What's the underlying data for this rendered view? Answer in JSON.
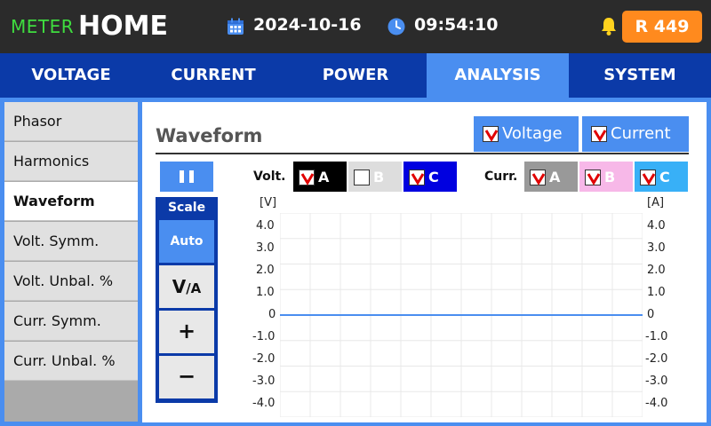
{
  "header": {
    "brand_small": "METER",
    "brand_big": "HOME",
    "date": "2024-10-16",
    "time": "09:54:10",
    "badge": "R 449",
    "icons": [
      "calendar-icon",
      "clock-icon",
      "bell-icon"
    ],
    "colors": {
      "brand_small": "#3fdc3f",
      "badge": "#ff8a1e",
      "bell": "#ffd21e"
    }
  },
  "tabs": [
    {
      "label": "VOLTAGE",
      "active": false
    },
    {
      "label": "CURRENT",
      "active": false
    },
    {
      "label": "POWER",
      "active": false
    },
    {
      "label": "ANALYSIS",
      "active": true
    },
    {
      "label": "SYSTEM",
      "active": false
    }
  ],
  "sidebar": {
    "items": [
      {
        "label": "Phasor",
        "active": false
      },
      {
        "label": "Harmonics",
        "active": false
      },
      {
        "label": "Waveform",
        "active": true
      },
      {
        "label": "Volt. Symm.",
        "active": false
      },
      {
        "label": "Volt. Unbal. %",
        "active": false
      },
      {
        "label": "Curr. Symm.",
        "active": false
      },
      {
        "label": "Curr. Unbal. %",
        "active": false
      }
    ]
  },
  "main": {
    "title": "Waveform",
    "toggles": {
      "voltage": {
        "label": "Voltage",
        "checked": true
      },
      "current": {
        "label": "Current",
        "checked": true
      }
    },
    "volt_label": "Volt.",
    "curr_label": "Curr.",
    "volt_phases": [
      {
        "label": "A",
        "checked": true,
        "color": "#000000"
      },
      {
        "label": "B",
        "checked": false,
        "color": "#dddddd"
      },
      {
        "label": "C",
        "checked": true,
        "color": "#0000e0"
      }
    ],
    "curr_phases": [
      {
        "label": "A",
        "checked": true,
        "color": "#999999"
      },
      {
        "label": "B",
        "checked": true,
        "color": "#f7b8e8"
      },
      {
        "label": "C",
        "checked": true,
        "color": "#38b0f7"
      }
    ],
    "scale": {
      "title": "Scale",
      "auto": "Auto",
      "va_main": "V",
      "va_sub": "/A",
      "plus": "+",
      "minus": "−"
    }
  },
  "chart_data": {
    "type": "line",
    "ylabel_left": "[V]",
    "ylabel_right": "[A]",
    "ylim": [
      -4.0,
      4.0
    ],
    "yticks_left": [
      "4.0",
      "3.0",
      "2.0",
      "1.0",
      "0",
      "-1.0",
      "-2.0",
      "-3.0",
      "-4.0"
    ],
    "yticks_right": [
      "4.0",
      "3.0",
      "2.0",
      "1.0",
      "0",
      "-1.0",
      "-2.0",
      "-3.0",
      "-4.0"
    ],
    "grid": true,
    "series": [
      {
        "values": [
          0,
          0,
          0,
          0,
          0,
          0,
          0,
          0,
          0,
          0,
          0,
          0
        ],
        "color": "#4a8ef0"
      }
    ]
  }
}
